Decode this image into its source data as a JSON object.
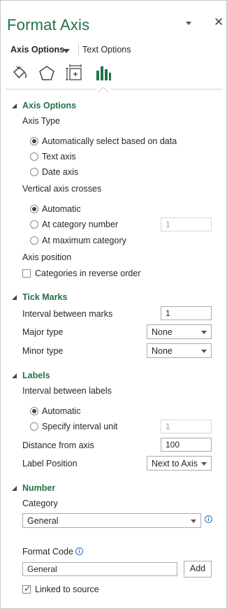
{
  "header": {
    "title": "Format Axis",
    "close_glyph": "✕"
  },
  "tabs": {
    "axis_options": "Axis Options",
    "text_options": "Text Options"
  },
  "icons": [
    "fill-line-icon",
    "effects-pentagon-icon",
    "size-properties-icon",
    "axis-options-bars-icon"
  ],
  "axis_options": {
    "heading": "Axis Options",
    "axis_type_label": "Axis Type",
    "auto_label": "Automatically select based on data",
    "text_axis_label": "Text axis",
    "date_axis_label": "Date axis",
    "vertical_crosses_label": "Vertical axis crosses",
    "automatic_label": "Automatic",
    "at_category_label": "At category number",
    "at_category_value": "1",
    "at_max_label": "At maximum category",
    "axis_position_label": "Axis position",
    "reverse_label": "Categories in reverse order"
  },
  "tick_marks": {
    "heading": "Tick Marks",
    "interval_label": "Interval between marks",
    "interval_value": "1",
    "major_label": "Major type",
    "major_value": "None",
    "minor_label": "Minor type",
    "minor_value": "None"
  },
  "labels": {
    "heading": "Labels",
    "interval_label": "Interval between labels",
    "automatic_label": "Automatic",
    "specify_label": "Specify interval unit",
    "specify_value": "1",
    "distance_label": "Distance from axis",
    "distance_value": "100",
    "position_label": "Label Position",
    "position_value": "Next to Axis"
  },
  "number": {
    "heading": "Number",
    "category_label": "Category",
    "category_value": "General",
    "format_code_label": "Format Code",
    "format_code_value": "General",
    "add_label": "Add",
    "linked_label": "Linked to source"
  },
  "colors": {
    "accent": "#217346",
    "info": "#2f6fb8"
  }
}
